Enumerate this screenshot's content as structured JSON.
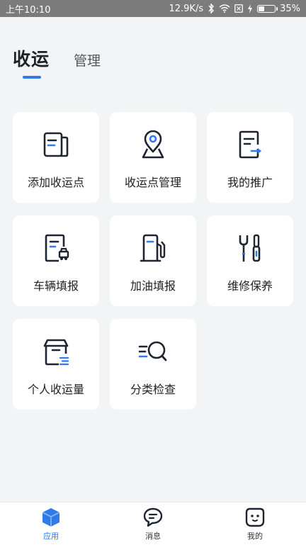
{
  "status_bar": {
    "time": "上午10:10",
    "speed": "12.9K/s",
    "battery": "35%",
    "icons": [
      "bluetooth-icon",
      "wifi-icon",
      "sim-icon",
      "charging-icon",
      "battery-icon"
    ]
  },
  "header": {
    "tabs": [
      {
        "label": "收运",
        "active": true
      },
      {
        "label": "管理",
        "active": false
      }
    ]
  },
  "apps": [
    {
      "label": "添加收运点",
      "icon": "document-icon"
    },
    {
      "label": "收运点管理",
      "icon": "location-pin-icon"
    },
    {
      "label": "我的推广",
      "icon": "document-arrow-icon"
    },
    {
      "label": "车辆填报",
      "icon": "document-truck-icon"
    },
    {
      "label": "加油填报",
      "icon": "fuel-pump-icon"
    },
    {
      "label": "维修保养",
      "icon": "tools-icon"
    },
    {
      "label": "个人收运量",
      "icon": "box-icon"
    },
    {
      "label": "分类检查",
      "icon": "list-search-icon"
    }
  ],
  "bottom_nav": [
    {
      "label": "应用",
      "icon": "cube-icon",
      "active": true
    },
    {
      "label": "消息",
      "icon": "chat-bubble-icon",
      "active": false
    },
    {
      "label": "我的",
      "icon": "face-icon",
      "active": false
    }
  ],
  "colors": {
    "accent": "#2e7be9",
    "icon_dark": "#1f2530",
    "background": "#f3f4f6",
    "card": "#ffffff"
  }
}
